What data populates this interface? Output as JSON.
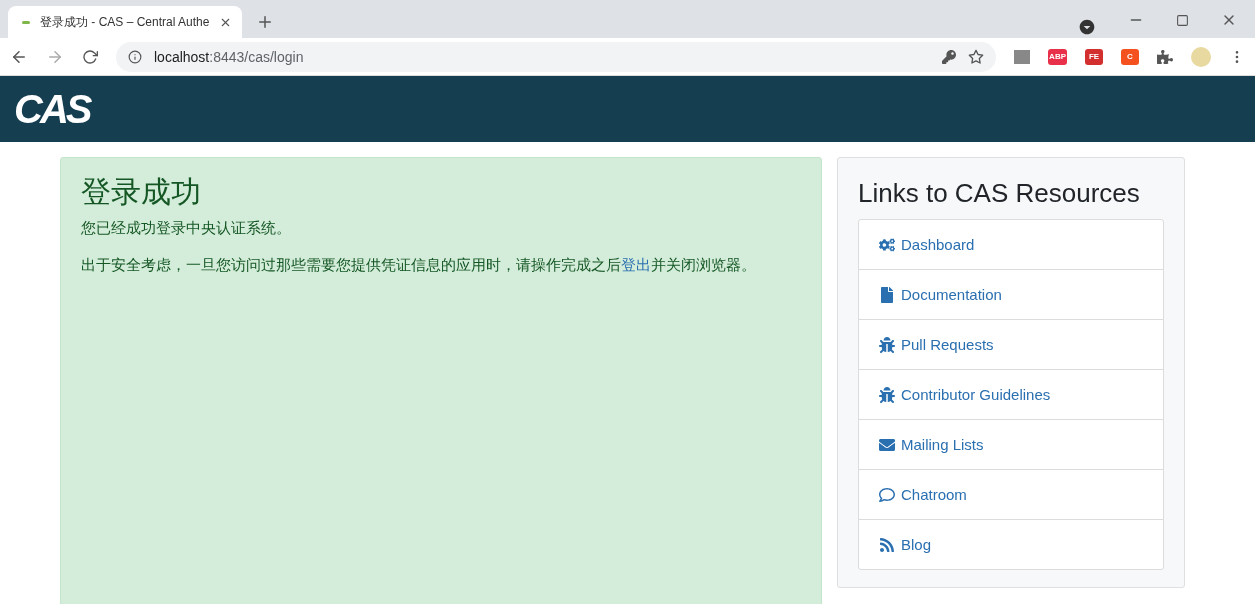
{
  "browser": {
    "tab_title": "登录成功 - CAS – Central Authe",
    "url_host": "localhost",
    "url_rest": ":8443/cas/login",
    "extensions": [
      "ABP",
      "FE",
      "C"
    ]
  },
  "header": {
    "logo": "CAS"
  },
  "message": {
    "title": "登录成功",
    "line": "您已经成功登录中央认证系统。",
    "notice_before": "出于安全考虑，一旦您访问过那些需要您提供凭证信息的应用时，请操作完成之后",
    "notice_link": "登出",
    "notice_after": "并关闭浏览器。"
  },
  "resources": {
    "title": "Links to CAS Resources",
    "links": [
      {
        "label": "Dashboard",
        "kind": "gears"
      },
      {
        "label": "Documentation",
        "kind": "file"
      },
      {
        "label": "Pull Requests",
        "kind": "bug"
      },
      {
        "label": "Contributor Guidelines",
        "kind": "bug"
      },
      {
        "label": "Mailing Lists",
        "kind": "envelope"
      },
      {
        "label": "Chatroom",
        "kind": "comment"
      },
      {
        "label": "Blog",
        "kind": "rss"
      }
    ]
  }
}
